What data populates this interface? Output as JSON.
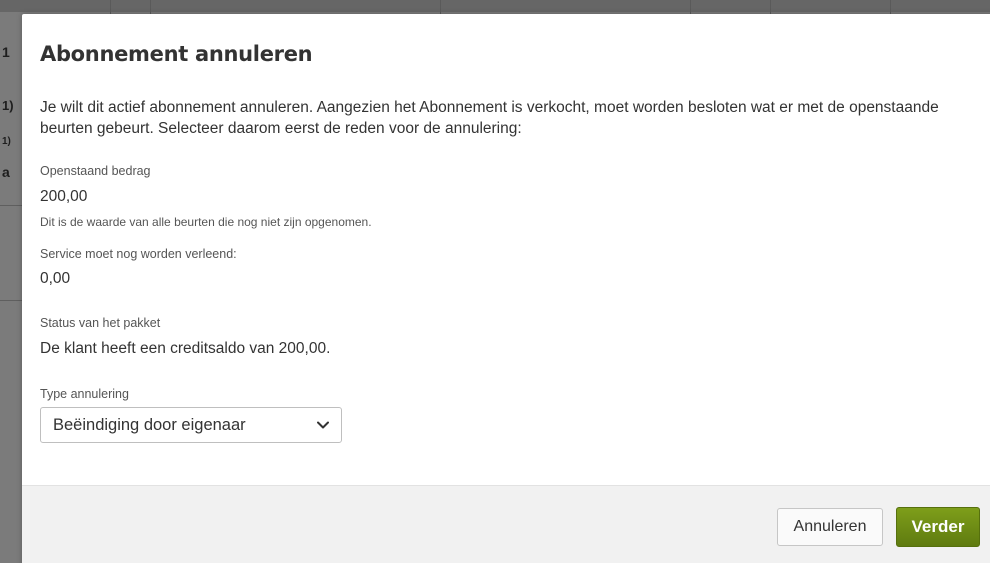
{
  "background": {
    "fragments": [
      "1",
      "1)",
      "1)",
      "a"
    ]
  },
  "modal": {
    "title": "Abonnement annuleren",
    "intro": "Je wilt dit actief abonnement annuleren. Aangezien het Abonnement is verkocht, moet worden besloten wat er met de openstaande beurten gebeurt. Selecteer daarom eerst de reden voor de annulering:",
    "outstanding_amount": {
      "label": "Openstaand bedrag",
      "value": "200,00",
      "help": "Dit is de waarde van alle beurten die nog niet zijn opgenomen."
    },
    "service_pending": {
      "label": "Service moet nog worden verleend:",
      "value": "0,00"
    },
    "package_status": {
      "label": "Status van het pakket",
      "value": "De klant heeft een creditsaldo van 200,00."
    },
    "cancellation_type": {
      "label": "Type annulering",
      "selected": "Beëindiging door eigenaar"
    },
    "footer": {
      "cancel_label": "Annuleren",
      "next_label": "Verder"
    }
  },
  "colors": {
    "overlay": "#7b7b7b",
    "accent_green": "#6b8a14",
    "text": "#333333"
  },
  "icons": {
    "dropdown": "chevron-down-icon"
  }
}
